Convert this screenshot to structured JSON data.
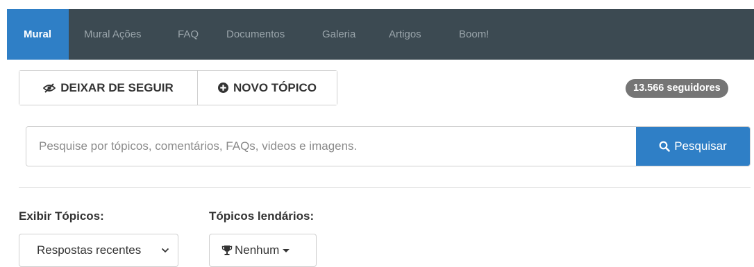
{
  "nav": {
    "tabs": [
      {
        "label": "Mural",
        "active": true
      },
      {
        "label": "Mural Ações",
        "active": false
      },
      {
        "label": "FAQ",
        "active": false
      },
      {
        "label": "Documentos",
        "active": false
      },
      {
        "label": "Galeria",
        "active": false
      },
      {
        "label": "Artigos",
        "active": false
      },
      {
        "label": "Boom!",
        "active": false
      }
    ]
  },
  "actions": {
    "unfollow_label": "DEIXAR DE SEGUIR",
    "unfollow_icon": "eye-slash-icon",
    "new_topic_label": "NOVO TÓPICO",
    "new_topic_icon": "plus-circle-icon"
  },
  "followers_badge": "13.566 seguidores",
  "search": {
    "placeholder": "Pesquise por tópicos, comentários, FAQs, videos e imagens.",
    "button_label": "Pesquisar",
    "button_icon": "search-icon"
  },
  "filters": {
    "show_topics_label": "Exibir Tópicos:",
    "show_topics_value": "Respostas recentes",
    "legendary_label": "Tópicos lendários:",
    "legendary_value": "Nenhum",
    "legendary_icon": "trophy-icon"
  },
  "colors": {
    "nav_bg": "#3c4a52",
    "accent": "#2f7fc6",
    "badge_bg": "#757575"
  }
}
